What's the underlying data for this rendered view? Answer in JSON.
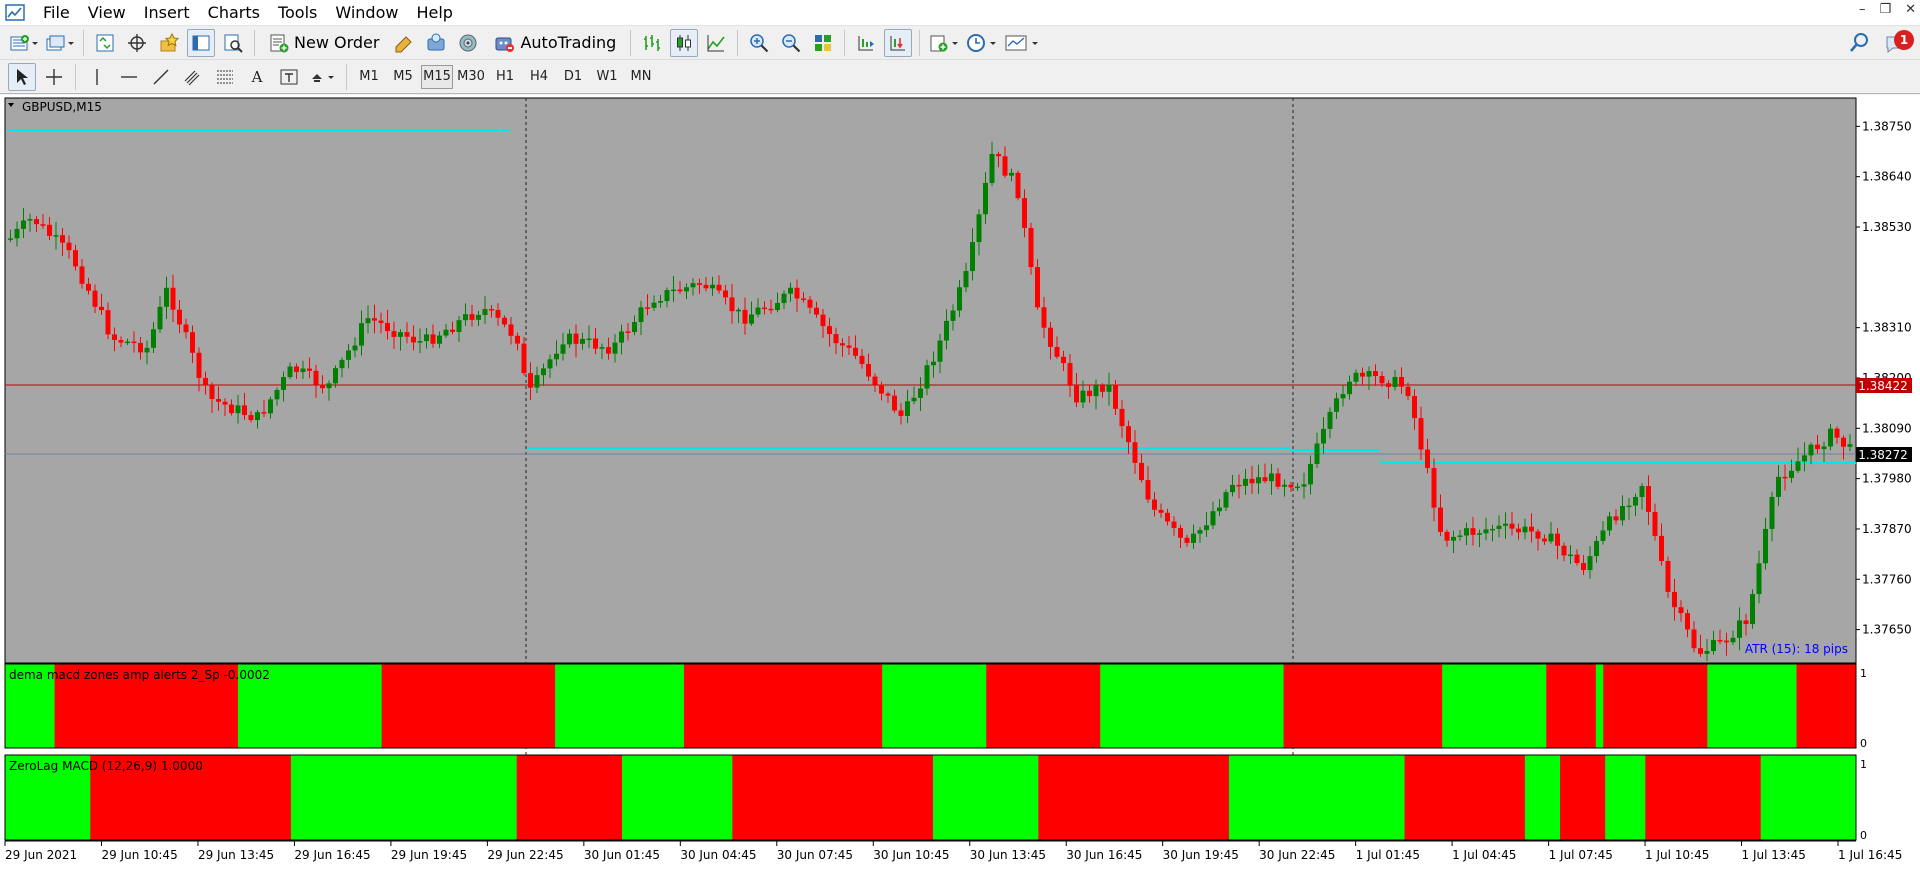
{
  "menu": {
    "items": [
      "File",
      "View",
      "Insert",
      "Charts",
      "Tools",
      "Window",
      "Help"
    ]
  },
  "toolbar": {
    "new_order_label": "New Order",
    "autotrading_label": "AutoTrading",
    "notification_count": "1"
  },
  "timeframes": [
    "M1",
    "M5",
    "M15",
    "M30",
    "H1",
    "H4",
    "D1",
    "W1",
    "MN"
  ],
  "timeframe_active": "M15",
  "colors": {
    "chart_bg": "#a6a6a6",
    "bull": "#008000",
    "bear": "#ff0000",
    "zone_green": "#00ff00",
    "zone_red": "#ff0000",
    "bid_line": "#c00000",
    "ask_line": "#6e82a0",
    "cyan_level": "#00e5ee",
    "atr_text": "#0000ff"
  },
  "chart": {
    "symbol_label": "GBPUSD,M15",
    "atr_label": "ATR (15): 18 pips",
    "bid_price_label": "1.38422",
    "ask_price_label": "1.38272",
    "price_ticks": [
      "1.38750",
      "1.38640",
      "1.38530",
      "1.38310",
      "1.38200",
      "1.38090",
      "1.37980",
      "1.37870",
      "1.37760",
      "1.37650"
    ],
    "time_ticks": [
      "29 Jun 2021",
      "29 Jun 10:45",
      "29 Jun 13:45",
      "29 Jun 16:45",
      "29 Jun 19:45",
      "29 Jun 22:45",
      "30 Jun 01:45",
      "30 Jun 04:45",
      "30 Jun 07:45",
      "30 Jun 10:45",
      "30 Jun 13:45",
      "30 Jun 16:45",
      "30 Jun 19:45",
      "30 Jun 22:45",
      "1 Jul 01:45",
      "1 Jul 04:45",
      "1 Jul 07:45",
      "1 Jul 10:45",
      "1 Jul 13:45",
      "1 Jul 16:45"
    ]
  },
  "indicator1": {
    "label": "dema macd zones amp alerts 2_Sp -0.0002",
    "scale_top": "1",
    "scale_bottom": "0",
    "zones": [
      {
        "c": "green",
        "w": 1.0
      },
      {
        "c": "red",
        "w": 3.7
      },
      {
        "c": "green",
        "w": 2.9
      },
      {
        "c": "red",
        "w": 3.5
      },
      {
        "c": "green",
        "w": 2.6
      },
      {
        "c": "red",
        "w": 4.0
      },
      {
        "c": "green",
        "w": 2.1
      },
      {
        "c": "red",
        "w": 2.3
      },
      {
        "c": "green",
        "w": 3.7
      },
      {
        "c": "red",
        "w": 3.2
      },
      {
        "c": "green",
        "w": 2.1
      },
      {
        "c": "red",
        "w": 1.0
      },
      {
        "c": "green",
        "w": 0.15
      },
      {
        "c": "red",
        "w": 2.1
      },
      {
        "c": "green",
        "w": 1.8
      },
      {
        "c": "red",
        "w": 1.2
      }
    ]
  },
  "indicator2": {
    "label": "ZeroLag MACD (12,26,9) 1.0000",
    "scale_top": "1",
    "scale_bottom": "0",
    "zones": [
      {
        "c": "green",
        "w": 1.7
      },
      {
        "c": "red",
        "w": 4.0
      },
      {
        "c": "green",
        "w": 4.5
      },
      {
        "c": "red",
        "w": 2.1
      },
      {
        "c": "green",
        "w": 2.2
      },
      {
        "c": "red",
        "w": 4.0
      },
      {
        "c": "green",
        "w": 2.1
      },
      {
        "c": "red",
        "w": 3.8
      },
      {
        "c": "green",
        "w": 3.5
      },
      {
        "c": "red",
        "w": 2.4
      },
      {
        "c": "green",
        "w": 0.7
      },
      {
        "c": "red",
        "w": 0.9
      },
      {
        "c": "green",
        "w": 0.8
      },
      {
        "c": "red",
        "w": 2.3
      },
      {
        "c": "green",
        "w": 1.9
      }
    ]
  }
}
